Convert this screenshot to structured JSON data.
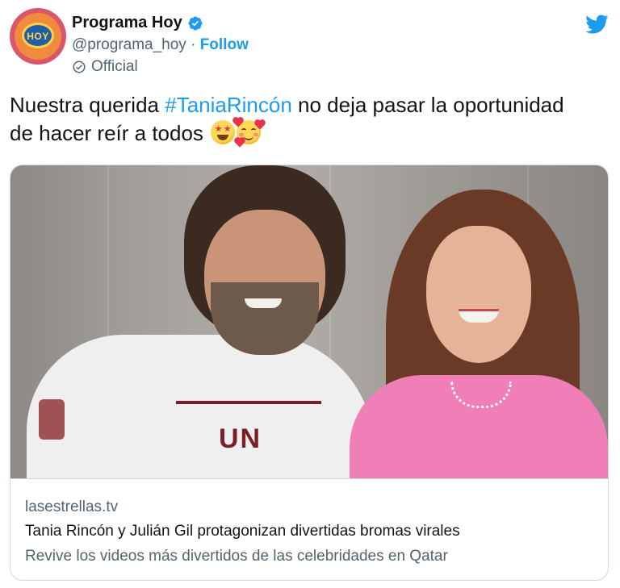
{
  "account": {
    "display_name": "Programa Hoy",
    "handle": "@programa_hoy",
    "separator": " · ",
    "follow_label": "Follow",
    "label": "Official",
    "avatar_text": "HOY"
  },
  "tweet": {
    "text_before": "Nuestra querida ",
    "hashtag": "#TaniaRincón",
    "text_after": " no deja pasar la oportunidad de hacer reír a todos",
    "emojis": [
      "star-struck",
      "smiling-face-with-hearts"
    ]
  },
  "card": {
    "domain": "lasestrellas.tv",
    "title": "Tania Rincón y Julián Gil protagonizan divertidas bromas virales",
    "description": "Revive los videos más divertidos de las celebridades en Qatar",
    "shirt_text": "UN"
  },
  "colors": {
    "accent": "#1d9bf0",
    "text": "#0f1419",
    "muted": "#536471",
    "border": "#cfd9de"
  }
}
